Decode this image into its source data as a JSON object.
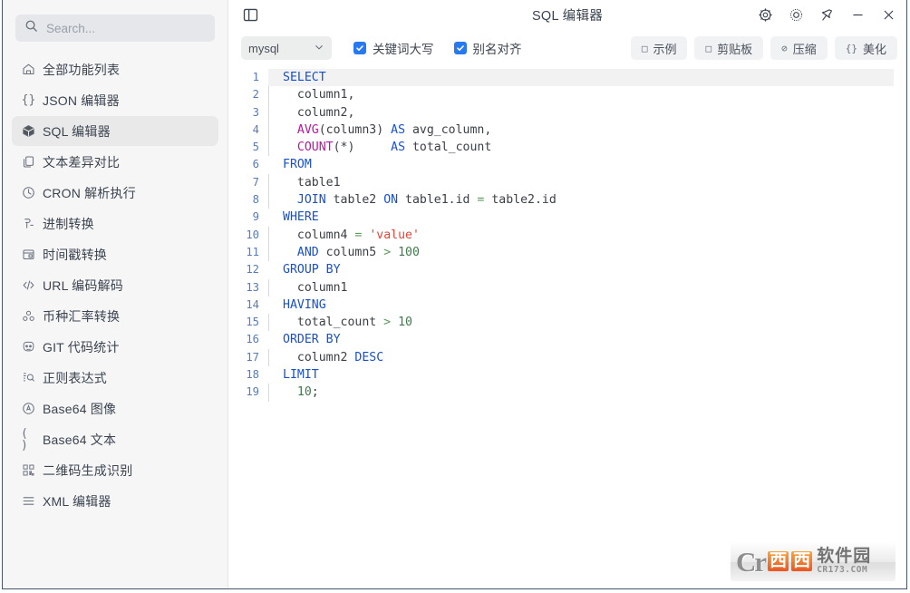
{
  "window": {
    "title": "SQL 编辑器",
    "controls": [
      {
        "name": "settings",
        "icon": "gear-icon"
      },
      {
        "name": "theme",
        "icon": "sun-icon"
      },
      {
        "name": "pin",
        "icon": "pin-icon"
      },
      {
        "name": "minimize",
        "icon": "minimize-icon"
      },
      {
        "name": "close",
        "icon": "close-icon"
      }
    ],
    "sidebar_toggle_icon": "panel-toggle-icon"
  },
  "sidebar": {
    "search": {
      "placeholder": "Search...",
      "value": "",
      "icon": "search-icon"
    },
    "items": [
      {
        "label": "全部功能列表",
        "icon": "home-icon",
        "glyph": "",
        "active": false
      },
      {
        "label": "JSON 编辑器",
        "icon": "braces-icon",
        "glyph": "{}",
        "active": false
      },
      {
        "label": "SQL 编辑器",
        "icon": "cube-icon",
        "glyph": "",
        "active": true
      },
      {
        "label": "文本差异对比",
        "icon": "copy-icon",
        "glyph": "",
        "active": false
      },
      {
        "label": "CRON 解析执行",
        "icon": "clock-icon",
        "glyph": "",
        "active": false
      },
      {
        "label": "进制转换",
        "icon": "binary-icon",
        "glyph": "",
        "active": false
      },
      {
        "label": "时间戳转换",
        "icon": "calendar-icon",
        "glyph": "",
        "active": false
      },
      {
        "label": "URL 编码解码",
        "icon": "code-icon",
        "glyph": "<>",
        "active": false
      },
      {
        "label": "币种汇率转换",
        "icon": "currency-icon",
        "glyph": "",
        "active": false
      },
      {
        "label": "GIT 代码统计",
        "icon": "git-icon",
        "glyph": "",
        "active": false
      },
      {
        "label": "正则表达式",
        "icon": "regex-icon",
        "glyph": "",
        "active": false
      },
      {
        "label": "Base64 图像",
        "icon": "image-circle-icon",
        "glyph": "",
        "active": false
      },
      {
        "label": "Base64 文本",
        "icon": "parens-icon",
        "glyph": "( )",
        "active": false
      },
      {
        "label": "二维码生成识别",
        "icon": "qrcode-icon",
        "glyph": "",
        "active": false
      },
      {
        "label": "XML 编辑器",
        "icon": "list-icon",
        "glyph": "",
        "active": false
      }
    ]
  },
  "toolbar": {
    "dialect": {
      "value": "mysql",
      "options": [
        "mysql"
      ],
      "chevron": "chevron-down-icon"
    },
    "checkboxes": [
      {
        "label": "关键词大写",
        "checked": true
      },
      {
        "label": "别名对齐",
        "checked": true
      }
    ],
    "actions": [
      {
        "label": "示例",
        "icon": "square-icon",
        "glyph": "□"
      },
      {
        "label": "剪贴板",
        "icon": "clipboard-icon",
        "glyph": "□"
      },
      {
        "label": "压缩",
        "icon": "compress-icon",
        "glyph": "⊘"
      },
      {
        "label": "美化",
        "icon": "braces-icon",
        "glyph": "{}"
      }
    ]
  },
  "editor": {
    "active_line": 1,
    "colors": {
      "keyword": "#1750cf",
      "function": "#b5199e",
      "string": "#e3443a",
      "number": "#3f7a4a",
      "operator": "#5a9a5a",
      "plain": "#3b4048",
      "line_number": "#5a7bb5",
      "active_line_bg": "#f2f2f2"
    },
    "lines": [
      {
        "n": 1,
        "indent": 0,
        "tokens": [
          {
            "t": "SELECT",
            "c": "k"
          }
        ]
      },
      {
        "n": 2,
        "indent": 1,
        "tokens": [
          {
            "t": "column1,",
            "c": "p"
          }
        ]
      },
      {
        "n": 3,
        "indent": 1,
        "tokens": [
          {
            "t": "column2,",
            "c": "p"
          }
        ]
      },
      {
        "n": 4,
        "indent": 1,
        "tokens": [
          {
            "t": "AVG",
            "c": "f"
          },
          {
            "t": "(column3) ",
            "c": "p"
          },
          {
            "t": "AS",
            "c": "k"
          },
          {
            "t": " avg_column,",
            "c": "p"
          }
        ]
      },
      {
        "n": 5,
        "indent": 1,
        "tokens": [
          {
            "t": "COUNT",
            "c": "f"
          },
          {
            "t": "(*)     ",
            "c": "p"
          },
          {
            "t": "AS",
            "c": "k"
          },
          {
            "t": " total_count",
            "c": "p"
          }
        ]
      },
      {
        "n": 6,
        "indent": 0,
        "tokens": [
          {
            "t": "FROM",
            "c": "k"
          }
        ]
      },
      {
        "n": 7,
        "indent": 1,
        "tokens": [
          {
            "t": "table1",
            "c": "p"
          }
        ]
      },
      {
        "n": 8,
        "indent": 1,
        "tokens": [
          {
            "t": "JOIN",
            "c": "k"
          },
          {
            "t": " table2 ",
            "c": "p"
          },
          {
            "t": "ON",
            "c": "k"
          },
          {
            "t": " table1.id ",
            "c": "p"
          },
          {
            "t": "=",
            "c": "o"
          },
          {
            "t": " table2.id",
            "c": "p"
          }
        ]
      },
      {
        "n": 9,
        "indent": 0,
        "tokens": [
          {
            "t": "WHERE",
            "c": "k"
          }
        ]
      },
      {
        "n": 10,
        "indent": 1,
        "tokens": [
          {
            "t": "column4 ",
            "c": "p"
          },
          {
            "t": "=",
            "c": "o"
          },
          {
            "t": " ",
            "c": "p"
          },
          {
            "t": "'value'",
            "c": "s"
          }
        ]
      },
      {
        "n": 11,
        "indent": 1,
        "tokens": [
          {
            "t": "AND",
            "c": "k"
          },
          {
            "t": " column5 ",
            "c": "p"
          },
          {
            "t": ">",
            "c": "o"
          },
          {
            "t": " ",
            "c": "p"
          },
          {
            "t": "100",
            "c": "n"
          }
        ]
      },
      {
        "n": 12,
        "indent": 0,
        "tokens": [
          {
            "t": "GROUP BY",
            "c": "k"
          }
        ]
      },
      {
        "n": 13,
        "indent": 1,
        "tokens": [
          {
            "t": "column1",
            "c": "p"
          }
        ]
      },
      {
        "n": 14,
        "indent": 0,
        "tokens": [
          {
            "t": "HAVING",
            "c": "k"
          }
        ]
      },
      {
        "n": 15,
        "indent": 1,
        "tokens": [
          {
            "t": "total_count ",
            "c": "p"
          },
          {
            "t": ">",
            "c": "o"
          },
          {
            "t": " ",
            "c": "p"
          },
          {
            "t": "10",
            "c": "n"
          }
        ]
      },
      {
        "n": 16,
        "indent": 0,
        "tokens": [
          {
            "t": "ORDER BY",
            "c": "k"
          }
        ]
      },
      {
        "n": 17,
        "indent": 1,
        "tokens": [
          {
            "t": "column2 ",
            "c": "p"
          },
          {
            "t": "DESC",
            "c": "k"
          }
        ]
      },
      {
        "n": 18,
        "indent": 0,
        "tokens": [
          {
            "t": "LIMIT",
            "c": "k"
          }
        ]
      },
      {
        "n": 19,
        "indent": 1,
        "tokens": [
          {
            "t": "10",
            "c": "n"
          },
          {
            "t": ";",
            "c": "p"
          }
        ]
      }
    ]
  },
  "watermark": {
    "logo_letters": "Cr",
    "brand_chars": [
      "西",
      "西"
    ],
    "brand_word": "软件园",
    "url": "CR173.COM"
  }
}
